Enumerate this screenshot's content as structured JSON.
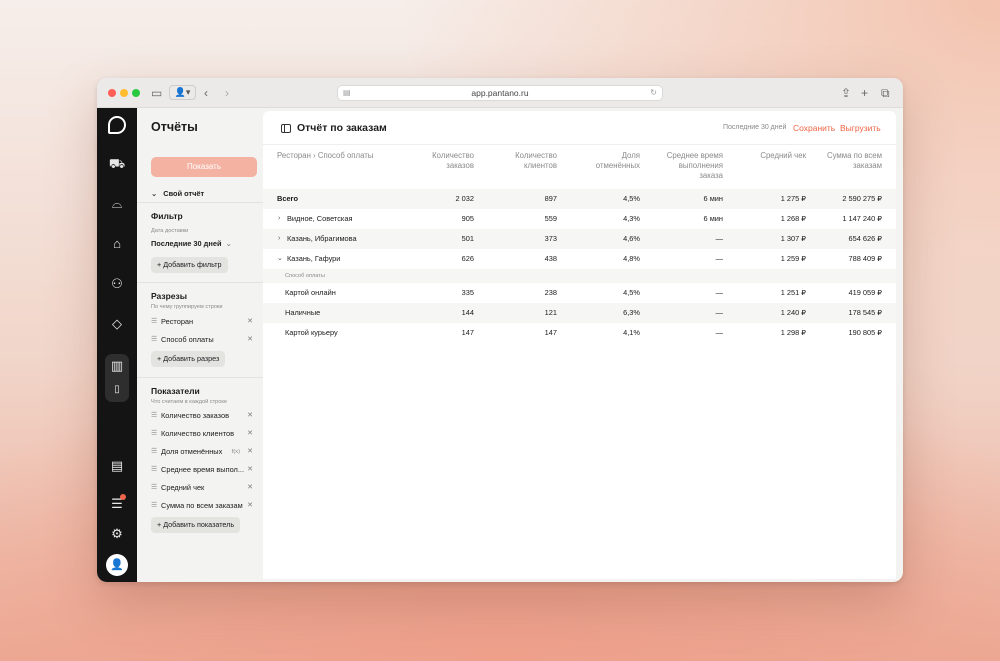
{
  "browser": {
    "url": "app.pantano.ru"
  },
  "sidebar": {
    "title": "Отчёты",
    "show_button": "Показать",
    "my_report": "Свой отчёт",
    "filter": {
      "heading": "Фильтр",
      "date_label": "Дата доставки",
      "date_value": "Последние 30 дней",
      "add_label": "Добавить фильтр"
    },
    "slices": {
      "heading": "Разрезы",
      "subtitle": "По чему группируем строки",
      "items": [
        {
          "label": "Ресторан"
        },
        {
          "label": "Способ оплаты"
        }
      ],
      "add_label": "Добавить разрез"
    },
    "metrics": {
      "heading": "Показатели",
      "subtitle": "Что считаем в каждой строке",
      "items": [
        {
          "label": "Количество заказов"
        },
        {
          "label": "Количество клиентов"
        },
        {
          "label": "Доля отменённых",
          "formula": "f(x)"
        },
        {
          "label": "Среднее время выпол..."
        },
        {
          "label": "Средний чек"
        },
        {
          "label": "Сумма по всем заказам"
        }
      ],
      "add_label": "Добавить показатель"
    }
  },
  "report": {
    "title": "Отчёт по заказам",
    "period": "Последние 30 дней",
    "save": "Сохранить",
    "export": "Выгрузить",
    "columns": [
      {
        "l1": "Ресторан › Способ оплаты",
        "l2": "",
        "l3": ""
      },
      {
        "l1": "Количество",
        "l2": "заказов",
        "l3": ""
      },
      {
        "l1": "Количество",
        "l2": "клиентов",
        "l3": ""
      },
      {
        "l1": "Доля",
        "l2": "отменённых",
        "l3": ""
      },
      {
        "l1": "Среднее время",
        "l2": "выполнения",
        "l3": "заказа"
      },
      {
        "l1": "Средний чек",
        "l2": "",
        "l3": ""
      },
      {
        "l1": "Сумма по всем",
        "l2": "заказам",
        "l3": ""
      }
    ],
    "group_label": "Способ оплаты",
    "rows": [
      {
        "name": "Всего",
        "orders": "2 032",
        "clients": "897",
        "cancel": "4,5%",
        "time": "6 мин",
        "avg": "1 275 ₽",
        "sum": "2 590 275 ₽"
      },
      {
        "name": "Видное, Советская",
        "orders": "905",
        "clients": "559",
        "cancel": "4,3%",
        "time": "6 мин",
        "avg": "1 268 ₽",
        "sum": "1 147 240 ₽"
      },
      {
        "name": "Казань, Ибрагимова",
        "orders": "501",
        "clients": "373",
        "cancel": "4,6%",
        "time": "—",
        "avg": "1 307 ₽",
        "sum": "654 626 ₽"
      },
      {
        "name": "Казань, Гафури",
        "orders": "626",
        "clients": "438",
        "cancel": "4,8%",
        "time": "—",
        "avg": "1 259 ₽",
        "sum": "788 409 ₽"
      },
      {
        "name": "Картой онлайн",
        "orders": "335",
        "clients": "238",
        "cancel": "4,5%",
        "time": "—",
        "avg": "1 251 ₽",
        "sum": "419 059 ₽"
      },
      {
        "name": "Наличные",
        "orders": "144",
        "clients": "121",
        "cancel": "6,3%",
        "time": "—",
        "avg": "1 240 ₽",
        "sum": "178 545 ₽"
      },
      {
        "name": "Картой курьеру",
        "orders": "147",
        "clients": "147",
        "cancel": "4,1%",
        "time": "—",
        "avg": "1 298 ₽",
        "sum": "190 805 ₽"
      }
    ]
  },
  "colors": {
    "accent": "#ee6444",
    "show_button": "#f4b2a3",
    "rail": "#141414"
  },
  "icons": [
    "logo-icon",
    "truck-icon",
    "cloche-icon",
    "store-icon",
    "users-icon",
    "ticket-icon",
    "chart-icon",
    "document-icon",
    "notes-icon",
    "list-icon",
    "settings-icon",
    "user-icon"
  ]
}
